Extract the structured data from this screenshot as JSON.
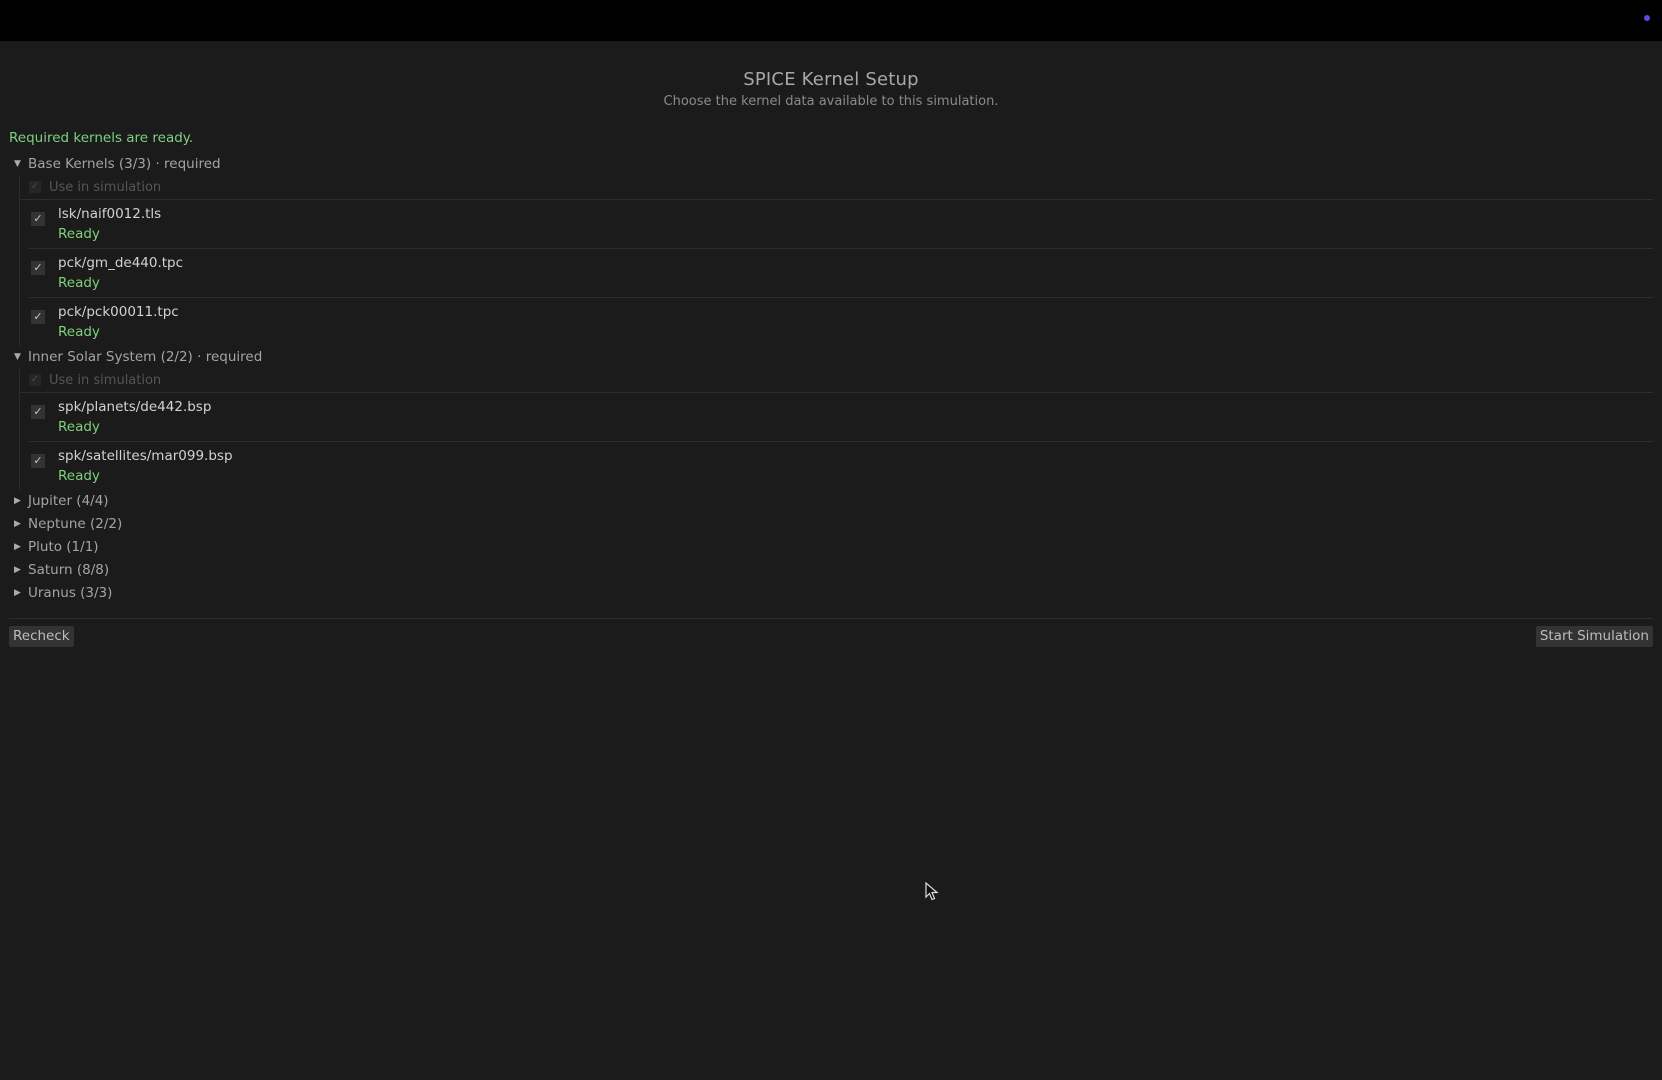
{
  "header": {
    "title": "SPICE Kernel Setup",
    "subtitle": "Choose the kernel data available to this simulation."
  },
  "status": "Required kernels are ready.",
  "use_label": "Use in simulation",
  "groups": [
    {
      "label": "Base Kernels  (3/3) · required",
      "expanded": true,
      "kernels": [
        {
          "name": "lsk/naif0012.tls",
          "status": "Ready"
        },
        {
          "name": "pck/gm_de440.tpc",
          "status": "Ready"
        },
        {
          "name": "pck/pck00011.tpc",
          "status": "Ready"
        }
      ]
    },
    {
      "label": "Inner Solar System  (2/2) · required",
      "expanded": true,
      "kernels": [
        {
          "name": "spk/planets/de442.bsp",
          "status": "Ready"
        },
        {
          "name": "spk/satellites/mar099.bsp",
          "status": "Ready"
        }
      ]
    },
    {
      "label": "Jupiter  (4/4)",
      "expanded": false
    },
    {
      "label": "Neptune  (2/2)",
      "expanded": false
    },
    {
      "label": "Pluto  (1/1)",
      "expanded": false
    },
    {
      "label": "Saturn  (8/8)",
      "expanded": false
    },
    {
      "label": "Uranus  (3/3)",
      "expanded": false
    }
  ],
  "buttons": {
    "recheck": "Recheck",
    "start": "Start Simulation"
  },
  "icons": {
    "expanded": "triangle-down-icon",
    "collapsed": "triangle-right-icon",
    "check": "checkmark-icon",
    "status_dot": "status-dot-icon",
    "cursor": "mouse-cursor-icon"
  },
  "colors": {
    "ready": "#7fd07f",
    "background": "#1b1b1b",
    "accent_dot": "#5b4de0"
  }
}
